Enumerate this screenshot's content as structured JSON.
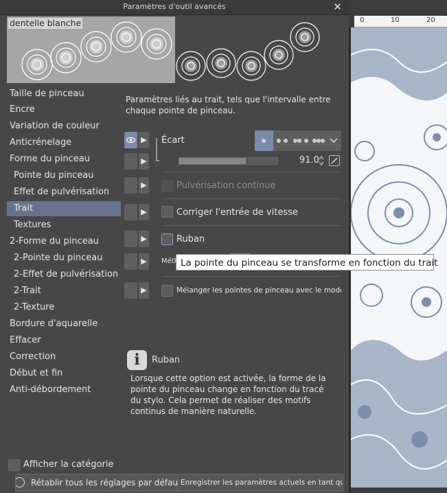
{
  "window": {
    "title": "Paramètres d'outil avancés",
    "close_glyph": "✕"
  },
  "preview": {
    "brush_name": "dentelle blanche"
  },
  "categories": [
    {
      "label": "Taille de pinceau"
    },
    {
      "label": "Encre"
    },
    {
      "label": "Variation de couleur"
    },
    {
      "label": "Anticrénelage"
    },
    {
      "label": "Forme du pinceau"
    },
    {
      "label": "Pointe du pinceau"
    },
    {
      "label": "Effet de pulvérisation"
    },
    {
      "label": "Trait"
    },
    {
      "label": "Textures"
    },
    {
      "label": "2-Forme du pinceau"
    },
    {
      "label": "2-Pointe du pinceau"
    },
    {
      "label": "2-Effet de pulvérisation"
    },
    {
      "label": "2-Trait"
    },
    {
      "label": "2-Texture"
    },
    {
      "label": "Bordure d'aquarelle"
    },
    {
      "label": "Effacer"
    },
    {
      "label": "Correction"
    },
    {
      "label": "Début et fin"
    },
    {
      "label": "Anti-débordement"
    }
  ],
  "selected_category": "Trait",
  "panel": {
    "description": "Paramètres liés au trait, tels que l'intervalle entre chaque pointe de pinceau.",
    "spacing_label": "Écart",
    "spacing_value": "91.0",
    "spacing_fraction": 0.68,
    "continuous_spray_label": "Pulvérisation continue",
    "speed_label": "Corriger l'entrée de vitesse",
    "ribbon_label": "Ruban",
    "method_label_partial": "Méth",
    "blend_label": "Mélanger les pointes de pinceau avec le mode Obscu"
  },
  "tooltip": {
    "text": "La pointe du pinceau se transforme en fonction du trait"
  },
  "info": {
    "title": "Ruban",
    "text": "Lorsque cette option est activée, la forme de la pointe du pinceau change en fonction du tracé du stylo. Cela permet de réaliser des motifs continus de manière naturelle."
  },
  "footer": {
    "show_category_label": "Afficher la catégorie",
    "reset_label": "Rétablir tous les réglages par défaut",
    "save_label": "Enregistrer les paramètres actuels en tant que para"
  },
  "ruler": {
    "ticks": [
      "0",
      "10",
      "20"
    ]
  },
  "colors": {
    "accent": "#68738b",
    "toggle_on": "#7b8aa8",
    "dialog_bg": "#474747",
    "lace_blue": "#a9b6c8"
  }
}
